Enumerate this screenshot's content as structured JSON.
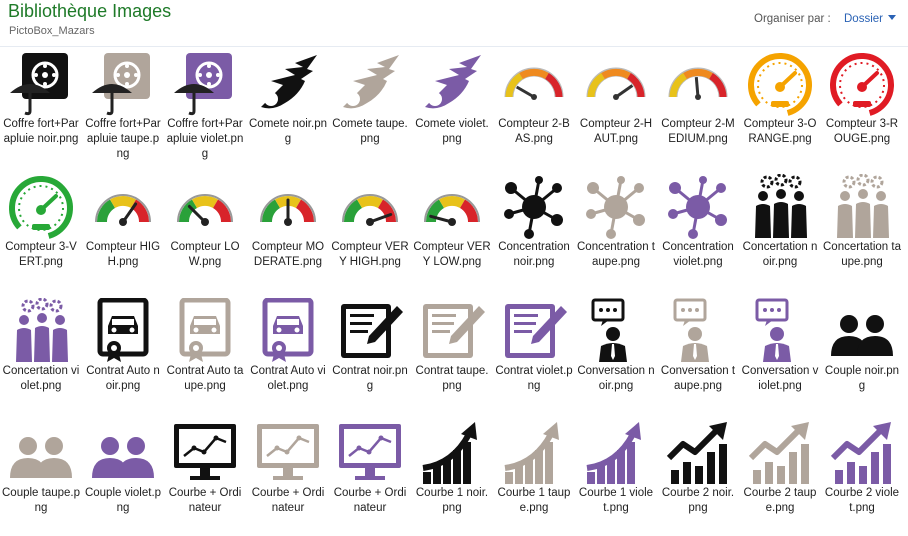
{
  "header": {
    "title": "Bibliothèque Images",
    "subtitle": "PictoBox_Mazars"
  },
  "toolbar": {
    "organize_label": "Organiser par :",
    "organize_value": "Dossier"
  },
  "colors": {
    "noir": "#111111",
    "taupe": "#b0a59b",
    "violet": "#7b5ba6",
    "title": "#1e7a28",
    "link": "#2a62b5"
  },
  "items": [
    {
      "label": "Coffre fort+Parapluie noir.png",
      "icon": "safe-umbrella",
      "color": "noir"
    },
    {
      "label": "Coffre fort+Parapluie taupe.png",
      "icon": "safe-umbrella",
      "color": "taupe"
    },
    {
      "label": "Coffre fort+Parapluie violet.png",
      "icon": "safe-umbrella",
      "color": "violet"
    },
    {
      "label": "Comete noir.png",
      "icon": "comet",
      "color": "noir"
    },
    {
      "label": "Comete taupe.png",
      "icon": "comet",
      "color": "taupe"
    },
    {
      "label": "Comete violet.png",
      "icon": "comet",
      "color": "violet"
    },
    {
      "label": "Compteur 2-BAS.png",
      "icon": "meter-flat",
      "color": "low"
    },
    {
      "label": "Compteur 2-HAUT.png",
      "icon": "meter-flat",
      "color": "high"
    },
    {
      "label": "Compteur 2-MEDIUM.png",
      "icon": "meter-flat",
      "color": "medium"
    },
    {
      "label": "Compteur 3-ORANGE.png",
      "icon": "speedometer",
      "color": "orange"
    },
    {
      "label": "Compteur 3-ROUGE.png",
      "icon": "speedometer",
      "color": "rouge"
    },
    {
      "label": "Compteur 3-VERT.png",
      "icon": "speedometer",
      "color": "vert"
    },
    {
      "label": "Compteur HIGH.png",
      "icon": "gauge",
      "color": "high"
    },
    {
      "label": "Compteur LOW.png",
      "icon": "gauge",
      "color": "low"
    },
    {
      "label": "Compteur MODERATE.png",
      "icon": "gauge",
      "color": "medium"
    },
    {
      "label": "Compteur VERY HIGH.png",
      "icon": "gauge",
      "color": "veryhigh"
    },
    {
      "label": "Compteur VERY LOW.png",
      "icon": "gauge",
      "color": "verylow"
    },
    {
      "label": "Concentration noir.png",
      "icon": "hub",
      "color": "noir"
    },
    {
      "label": "Concentration taupe.png",
      "icon": "hub",
      "color": "taupe"
    },
    {
      "label": "Concentration violet.png",
      "icon": "hub",
      "color": "violet"
    },
    {
      "label": "Concertation noir.png",
      "icon": "people-gears",
      "color": "noir"
    },
    {
      "label": "Concertation taupe.png",
      "icon": "people-gears",
      "color": "taupe"
    },
    {
      "label": "Concertation violet.png",
      "icon": "people-gears",
      "color": "violet"
    },
    {
      "label": "Contrat Auto noir.png",
      "icon": "car-contract",
      "color": "noir"
    },
    {
      "label": "Contrat Auto taupe.png",
      "icon": "car-contract",
      "color": "taupe"
    },
    {
      "label": "Contrat Auto violet.png",
      "icon": "car-contract",
      "color": "violet"
    },
    {
      "label": "Contrat noir.png",
      "icon": "contract",
      "color": "noir"
    },
    {
      "label": "Contrat taupe.png",
      "icon": "contract",
      "color": "taupe"
    },
    {
      "label": "Contrat violet.png",
      "icon": "contract",
      "color": "violet"
    },
    {
      "label": "Conversation noir.png",
      "icon": "conversation",
      "color": "noir"
    },
    {
      "label": "Conversation taupe.png",
      "icon": "conversation",
      "color": "taupe"
    },
    {
      "label": "Conversation violet.png",
      "icon": "conversation",
      "color": "violet"
    },
    {
      "label": "Couple noir.png",
      "icon": "couple",
      "color": "noir"
    },
    {
      "label": "Couple taupe.png",
      "icon": "couple",
      "color": "taupe"
    },
    {
      "label": "Couple violet.png",
      "icon": "couple",
      "color": "violet"
    },
    {
      "label": "Courbe + Ordinateur",
      "icon": "monitor-chart",
      "color": "noir"
    },
    {
      "label": "Courbe + Ordinateur",
      "icon": "monitor-chart",
      "color": "taupe"
    },
    {
      "label": "Courbe + Ordinateur",
      "icon": "monitor-chart",
      "color": "violet"
    },
    {
      "label": "Courbe 1 noir.png",
      "icon": "curve-bars",
      "color": "noir"
    },
    {
      "label": "Courbe 1 taupe.png",
      "icon": "curve-bars",
      "color": "taupe"
    },
    {
      "label": "Courbe 1 violet.png",
      "icon": "curve-bars",
      "color": "violet"
    },
    {
      "label": "Courbe 2 noir.png",
      "icon": "zigzag-bars",
      "color": "noir"
    },
    {
      "label": "Courbe 2 taupe.png",
      "icon": "zigzag-bars",
      "color": "taupe"
    },
    {
      "label": "Courbe 2 violet.png",
      "icon": "zigzag-bars",
      "color": "violet"
    }
  ]
}
